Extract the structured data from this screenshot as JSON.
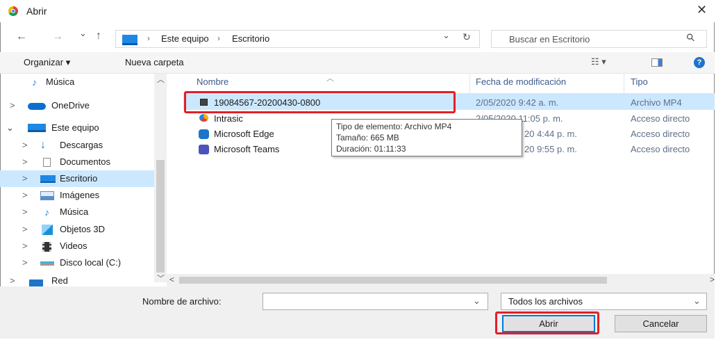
{
  "window": {
    "title": "Abrir",
    "close_glyph": "✕"
  },
  "nav_buttons": {
    "back": "←",
    "forward": "→",
    "recent": "⌄",
    "up": "↑"
  },
  "address": {
    "breadcrumb": [
      "Este equipo",
      "Escritorio"
    ],
    "separator": "›",
    "dropdown": "⌄",
    "refresh": "↻"
  },
  "search": {
    "placeholder": "Buscar en Escritorio",
    "icon": "⚲"
  },
  "toolbar": {
    "organize": "Organizar ▾",
    "new_folder": "Nueva carpeta",
    "view_menu": "☷ ▾",
    "help": "?"
  },
  "sidebar": {
    "items": [
      {
        "label": "Música",
        "icon": "music-icon",
        "color": "#1e88e5",
        "expander": ""
      },
      {
        "label": "OneDrive",
        "icon": "cloud-icon",
        "color": "#0b6fd1",
        "expander": ">"
      },
      {
        "label": "Este equipo",
        "icon": "pc-icon",
        "color": "#1e88e5",
        "expander": "⌄"
      },
      {
        "label": "Descargas",
        "icon": "download-icon",
        "color": "#1e74c8",
        "expander": ">"
      },
      {
        "label": "Documentos",
        "icon": "document-icon",
        "color": "#8a8a8a",
        "expander": ">"
      },
      {
        "label": "Escritorio",
        "icon": "desktop-icon",
        "color": "#1e88e5",
        "expander": ">",
        "selected": true
      },
      {
        "label": "Imágenes",
        "icon": "images-icon",
        "color": "#5b8ec9",
        "expander": ">"
      },
      {
        "label": "Música",
        "icon": "music-icon",
        "color": "#1e88e5",
        "expander": ">"
      },
      {
        "label": "Objetos 3D",
        "icon": "cube-icon",
        "color": "#3fa9e6",
        "expander": ">"
      },
      {
        "label": "Videos",
        "icon": "film-icon",
        "color": "#333333",
        "expander": ">"
      },
      {
        "label": "Disco local (C:)",
        "icon": "drive-icon",
        "color": "#7a7a7a",
        "expander": ">"
      },
      {
        "label": "Red",
        "icon": "network-icon",
        "color": "#1e74c8",
        "expander": ">"
      }
    ]
  },
  "columns": {
    "name": "Nombre",
    "modified": "Fecha de modificación",
    "type": "Tipo",
    "sort_glyph": "︿"
  },
  "files": [
    {
      "name": "19084567-20200430-0800",
      "modified": "2/05/2020 9:42 a. m.",
      "type": "Archivo MP4",
      "icon": "video-file-icon"
    },
    {
      "name": "Intrasic",
      "modified": "2/05/2020 11:05 p. m.",
      "type": "Acceso directo",
      "icon": "shortcut-icon"
    },
    {
      "name": "Microsoft Edge",
      "modified": "20 4:44 p. m.",
      "type": "Acceso directo",
      "icon": "edge-icon"
    },
    {
      "name": "Microsoft Teams",
      "modified": "20 9:55 p. m.",
      "type": "Acceso directo",
      "icon": "teams-icon"
    }
  ],
  "tooltip": {
    "line1": "Tipo de elemento: Archivo MP4",
    "line2": "Tamaño: 665 MB",
    "line3": "Duración: 01:11:33"
  },
  "footer": {
    "filename_label": "Nombre de archivo:",
    "filename_value": "",
    "filetype_value": "Todos los archivos",
    "open_label": "Abrir",
    "cancel_label": "Cancelar"
  },
  "colors": {
    "highlight_red": "#e0202a",
    "selection_blue": "#cce8ff",
    "accent_blue": "#1e74c8"
  }
}
